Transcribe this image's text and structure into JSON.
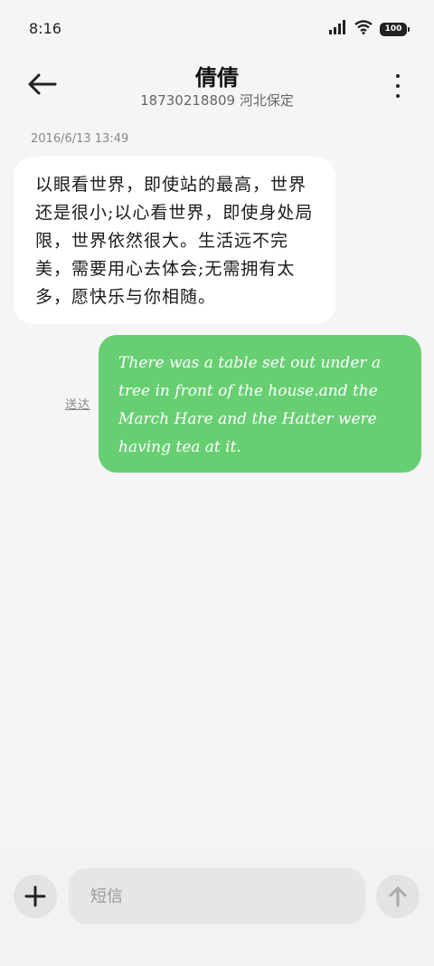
{
  "status_bar": {
    "time": "8:16",
    "battery": "100",
    "icons": [
      "signal-icon",
      "wifi-icon",
      "battery-icon"
    ]
  },
  "header": {
    "title": "倩倩",
    "subtitle": "18730218809 河北保定",
    "back_icon": "back-arrow-icon",
    "more_icon": "more-vertical-icon"
  },
  "conversation": {
    "timestamp": "2016/6/13 13:49",
    "messages": [
      {
        "direction": "incoming",
        "text": "以眼看世界，即使站的最高，世界还是很小;以心看世界，即使身处局限，世界依然很大。生活远不完美，需要用心去体会;无需拥有太多，愿快乐与你相随。"
      },
      {
        "direction": "outgoing",
        "text": "There was a table set out under a tree in front of the house.and the March Hare and the Hatter were having tea at it.",
        "status": "送达"
      }
    ]
  },
  "composer": {
    "placeholder": "短信",
    "add_icon": "plus-icon",
    "send_icon": "send-arrow-icon"
  },
  "colors": {
    "background": "#f5f5f5",
    "incoming_bubble": "#ffffff",
    "outgoing_bubble": "#67cf72"
  }
}
